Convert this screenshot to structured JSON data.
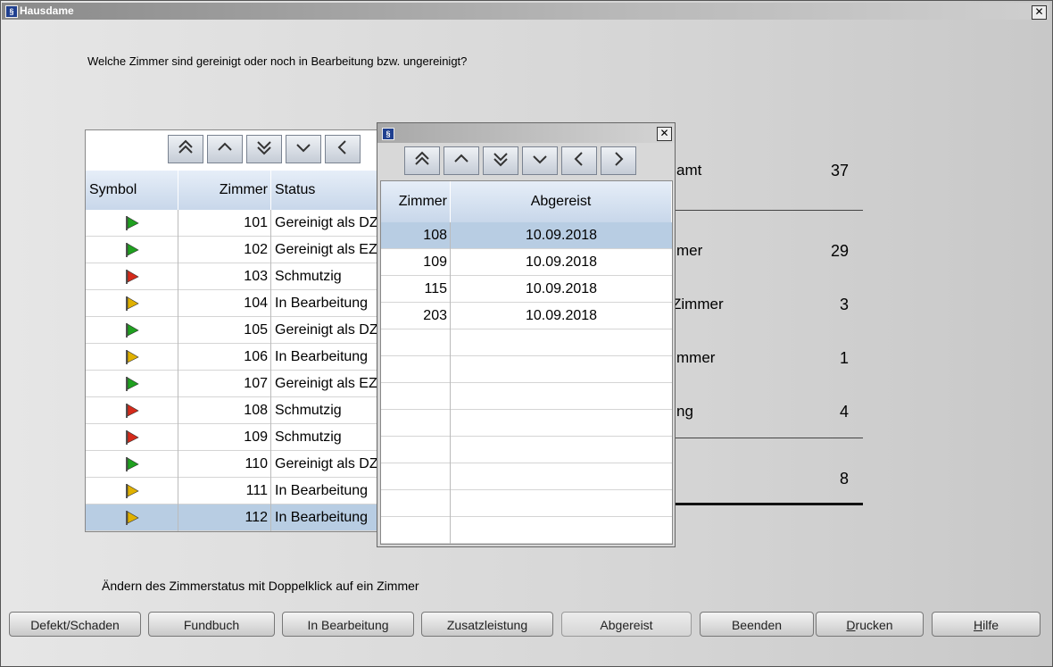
{
  "window": {
    "title": "Hausdame",
    "close": "✕"
  },
  "question": "Welche Zimmer sind gereinigt oder noch in Bearbeitung bzw. ungereinigt?",
  "hint": "Ändern des Zimmerstatus mit Doppelklick auf ein Zimmer",
  "colors": {
    "green": "#1fa01f",
    "red": "#d42a1a",
    "yellow": "#e0b100",
    "selection": "#b8cde3"
  },
  "room_table": {
    "headers": {
      "symbol": "Symbol",
      "zimmer": "Zimmer",
      "status": "Status"
    },
    "rows": [
      {
        "flag": "green",
        "zimmer": "101",
        "status": "Gereinigt als DZ"
      },
      {
        "flag": "green",
        "zimmer": "102",
        "status": "Gereinigt als EZ"
      },
      {
        "flag": "red",
        "zimmer": "103",
        "status": "Schmutzig"
      },
      {
        "flag": "yellow",
        "zimmer": "104",
        "status": "In Bearbeitung"
      },
      {
        "flag": "green",
        "zimmer": "105",
        "status": "Gereinigt als DZ"
      },
      {
        "flag": "yellow",
        "zimmer": "106",
        "status": "In Bearbeitung"
      },
      {
        "flag": "green",
        "zimmer": "107",
        "status": "Gereinigt als EZ"
      },
      {
        "flag": "red",
        "zimmer": "108",
        "status": "Schmutzig"
      },
      {
        "flag": "red",
        "zimmer": "109",
        "status": "Schmutzig"
      },
      {
        "flag": "green",
        "zimmer": "110",
        "status": "Gereinigt als DZ"
      },
      {
        "flag": "yellow",
        "zimmer": "111",
        "status": "In Bearbeitung"
      },
      {
        "flag": "yellow",
        "zimmer": "112",
        "status": "In Bearbeitung",
        "selected": true
      }
    ]
  },
  "stats": [
    {
      "label": "amt",
      "value": "37"
    },
    {
      "label": "mer",
      "value": "29"
    },
    {
      "label": "Zimmer",
      "value": "3"
    },
    {
      "label": "mmer",
      "value": "1"
    },
    {
      "label": "ng",
      "value": "4"
    },
    {
      "label": "",
      "value": "8"
    }
  ],
  "popup": {
    "close": "✕",
    "headers": {
      "zimmer": "Zimmer",
      "abgereist": "Abgereist"
    },
    "rows": [
      {
        "zimmer": "108",
        "date": "10.09.2018",
        "selected": true
      },
      {
        "zimmer": "109",
        "date": "10.09.2018"
      },
      {
        "zimmer": "115",
        "date": "10.09.2018"
      },
      {
        "zimmer": "203",
        "date": "10.09.2018"
      }
    ],
    "empty_rows": 8
  },
  "nav_icons": [
    "double-up-icon",
    "up-icon",
    "double-down-icon",
    "down-icon",
    "left-icon",
    "right-icon"
  ],
  "buttons": [
    {
      "label": "Defekt/Schaden"
    },
    {
      "label": "Fundbuch"
    },
    {
      "label": "In Bearbeitung"
    },
    {
      "label": "Zusatzleistung"
    },
    {
      "label": "Abgereist"
    },
    {
      "label": "Beenden"
    },
    {
      "label": "Drucken"
    },
    {
      "label": "Hilfe"
    }
  ]
}
